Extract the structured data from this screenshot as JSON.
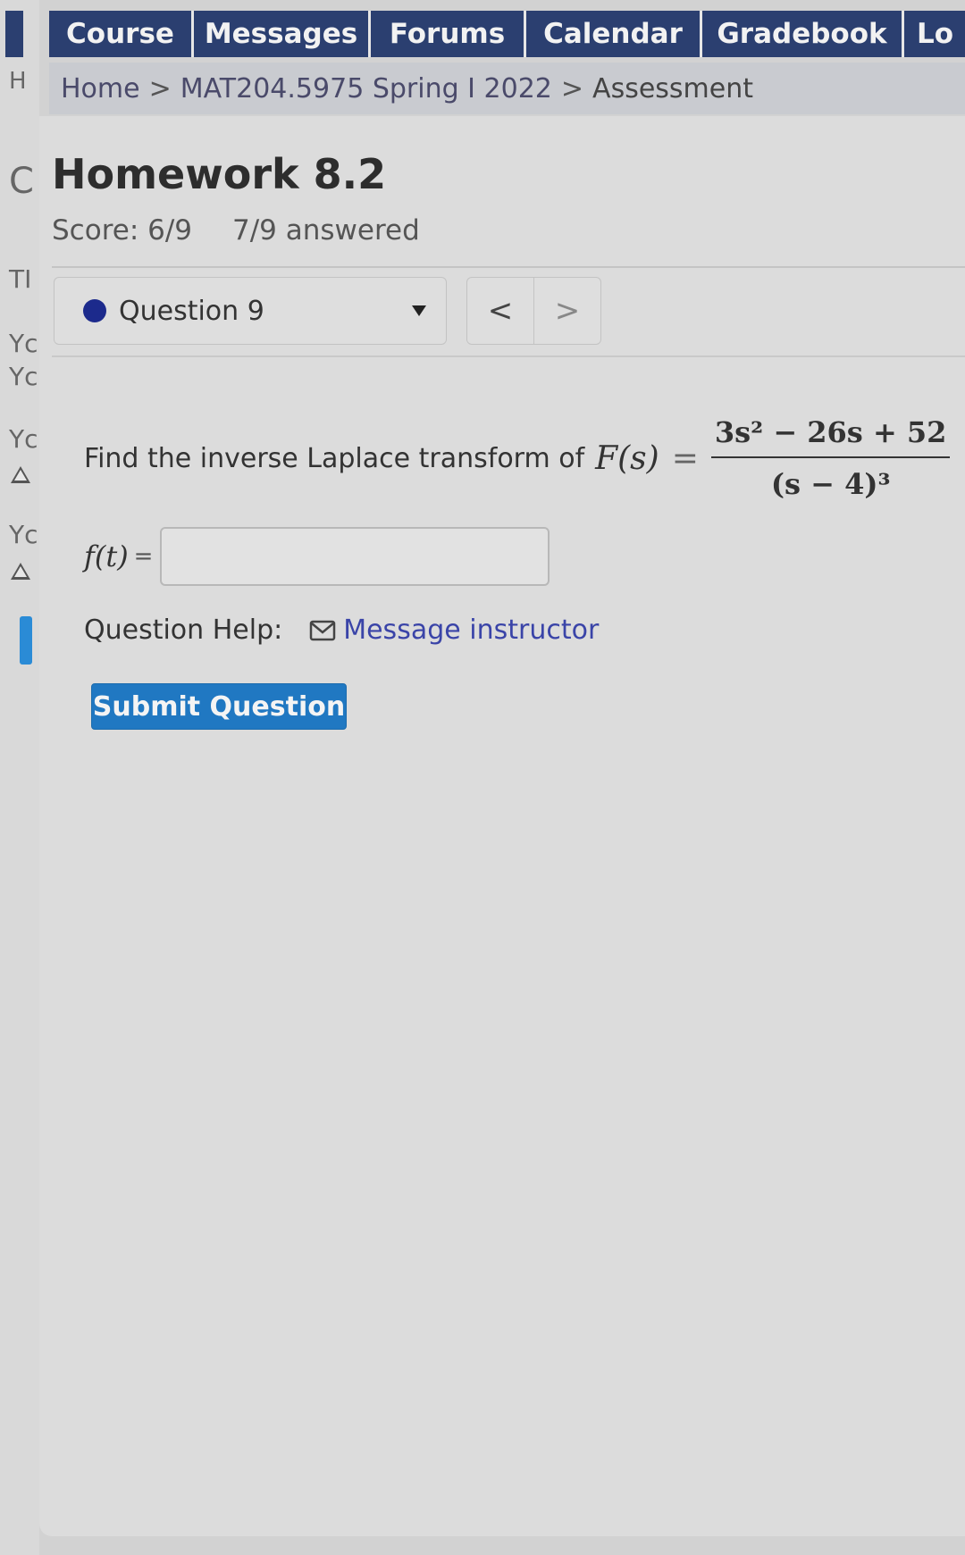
{
  "nav": {
    "tabs": [
      {
        "label": "Course"
      },
      {
        "label": "Messages"
      },
      {
        "label": "Forums"
      },
      {
        "label": "Calendar"
      },
      {
        "label": "Gradebook"
      },
      {
        "label": "Lo"
      }
    ]
  },
  "breadcrumb": {
    "edge_fragment": "H",
    "items": [
      "Home",
      "MAT204.5975 Spring I 2022",
      "Assessment"
    ],
    "separator": ">"
  },
  "left_fragments": [
    "C",
    "TI",
    "Yc",
    "Yc",
    "Yc",
    "Yc"
  ],
  "assessment": {
    "title": "Homework 8.2",
    "score": "Score: 6/9",
    "answered": "7/9 answered"
  },
  "question_nav": {
    "selected": "Question 9",
    "prev_icon": "<",
    "next_icon": ">"
  },
  "question": {
    "prompt": "Find the inverse Laplace transform of",
    "function_lhs": "F(s)",
    "equals": "=",
    "numerator": "3s² − 26s + 52",
    "denominator": "(s − 4)³",
    "answer_label": "f(t)",
    "answer_equals": "=",
    "answer_value": ""
  },
  "help": {
    "label": "Question Help:",
    "link": "Message instructor"
  },
  "submit_label": "Submit Question",
  "colors": {
    "nav_bg": "#2b3f70",
    "submit_bg": "#2078c2",
    "link": "#3a44a8",
    "status_dot": "#1c2a8c"
  }
}
